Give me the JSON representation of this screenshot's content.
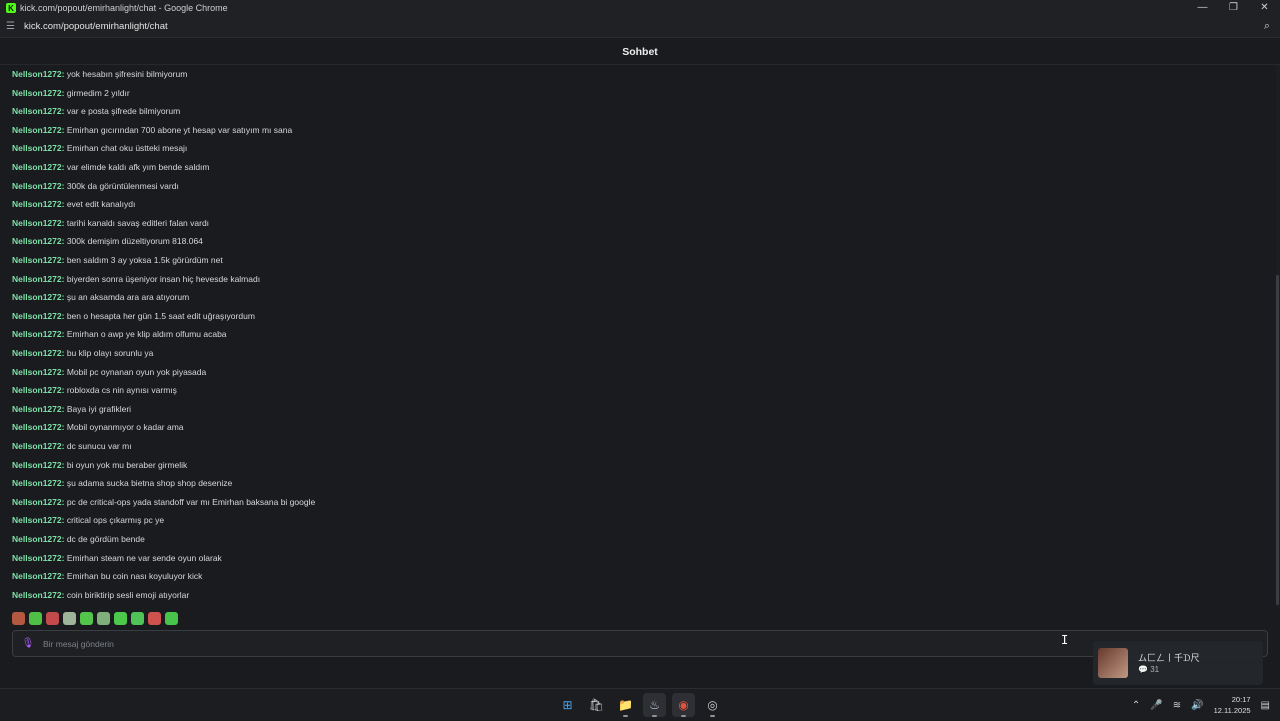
{
  "window": {
    "title": "kick.com/popout/emirhanlight/chat - Google Chrome",
    "app_icon": "K",
    "controls": [
      "—",
      "❐",
      "✕"
    ]
  },
  "browser": {
    "url": "kick.com/popout/emirhanlight/chat"
  },
  "chat": {
    "title": "Sohbet",
    "messages": [
      {
        "user": "Nellson1272:",
        "text": "yok hesabın şifresini bilmiyorum"
      },
      {
        "user": "Nellson1272:",
        "text": "girmedim 2 yıldır"
      },
      {
        "user": "Nellson1272:",
        "text": "var e posta şifrede bilmiyorum"
      },
      {
        "user": "Nellson1272:",
        "text": "Emirhan gıcırından 700 abone yt hesap var satıyım mı sana"
      },
      {
        "user": "Nellson1272:",
        "text": "Emirhan chat oku üstteki mesajı"
      },
      {
        "user": "Nellson1272:",
        "text": "var elimde kaldı afk yım bende saldım"
      },
      {
        "user": "Nellson1272:",
        "text": "300k da görüntülenmesi vardı"
      },
      {
        "user": "Nellson1272:",
        "text": "evet edit kanalıydı"
      },
      {
        "user": "Nellson1272:",
        "text": "tarihi kanaldı savaş editleri falan vardı"
      },
      {
        "user": "Nellson1272:",
        "text": "300k demişim düzeltiyorum 818.064"
      },
      {
        "user": "Nellson1272:",
        "text": "ben saldım 3 ay yoksa 1.5k görürdüm net"
      },
      {
        "user": "Nellson1272:",
        "text": "biyerden sonra üşeniyor insan hiç hevesde kalmadı"
      },
      {
        "user": "Nellson1272:",
        "text": "şu an aksamda ara ara atıyorum"
      },
      {
        "user": "Nellson1272:",
        "text": "ben o hesapta her gün 1.5 saat edit uğraşıyordum"
      },
      {
        "user": "Nellson1272:",
        "text": "Emirhan o awp ye klip aldım olfumu acaba"
      },
      {
        "user": "Nellson1272:",
        "text": "bu klip olayı sorunlu ya"
      },
      {
        "user": "Nellson1272:",
        "text": "Mobil pc oynanan oyun yok piyasada"
      },
      {
        "user": "Nellson1272:",
        "text": "robloxda cs nin aynısı varmış"
      },
      {
        "user": "Nellson1272:",
        "text": "Baya iyi grafikleri"
      },
      {
        "user": "Nellson1272:",
        "text": "Mobil oynanmıyor o kadar ama"
      },
      {
        "user": "Nellson1272:",
        "text": "dc sunucu var mı"
      },
      {
        "user": "Nellson1272:",
        "text": "bi oyun yok mu beraber girmelik"
      },
      {
        "user": "Nellson1272:",
        "text": "şu adama sucka bietna shop shop desenize"
      },
      {
        "user": "Nellson1272:",
        "text": "pc de critical-ops yada standoff var mı Emirhan baksana bi google"
      },
      {
        "user": "Nellson1272:",
        "text": "critical ops çıkarmış pc ye"
      },
      {
        "user": "Nellson1272:",
        "text": "dc de gördüm bende"
      },
      {
        "user": "Nellson1272:",
        "text": "Emirhan steam ne var sende oyun olarak"
      },
      {
        "user": "Nellson1272:",
        "text": "Emirhan bu coin nası koyuluyor kick"
      },
      {
        "user": "Nellson1272:",
        "text": "coin biriktirip sesli emoji atıyorlar"
      }
    ],
    "emotes": [
      {
        "name": "emote-1-icon",
        "color": "#b4583f"
      },
      {
        "name": "emote-2-icon",
        "color": "#4fbf45"
      },
      {
        "name": "emote-3-icon",
        "color": "#c34a4a"
      },
      {
        "name": "emote-4-icon",
        "color": "#9fb59a"
      },
      {
        "name": "emote-5-icon",
        "color": "#52c54a"
      },
      {
        "name": "emote-6-icon",
        "color": "#7fb07c"
      },
      {
        "name": "emote-7-icon",
        "color": "#4cc94a"
      },
      {
        "name": "emote-8-icon",
        "color": "#4fc258"
      },
      {
        "name": "emote-9-icon",
        "color": "#d0524e"
      },
      {
        "name": "emote-10-icon",
        "color": "#48c44a"
      }
    ],
    "input": {
      "placeholder": "Bir mesaj gönderin",
      "value": ""
    }
  },
  "notification": {
    "title": "ム匚ㄥ丨千ᗪ尺",
    "count": "31"
  },
  "taskbar": {
    "apps": [
      {
        "name": "start-icon",
        "glyph": "⊞",
        "color": "#4aa3e8"
      },
      {
        "name": "store-icon",
        "glyph": "🛍",
        "color": "#c9c9c9"
      },
      {
        "name": "file-explorer-icon",
        "glyph": "📁",
        "color": "#e8b84a"
      },
      {
        "name": "steam-icon",
        "glyph": "♨",
        "color": "#c7d5e0"
      },
      {
        "name": "chrome-icon",
        "glyph": "◉",
        "color": "#e0533f"
      },
      {
        "name": "discord-icon",
        "glyph": "◎",
        "color": "#cfcfcf"
      }
    ],
    "time": "20:17",
    "date": "12.11.2025"
  },
  "colors": {
    "background": "#191b1f",
    "username": "#7fe0a8",
    "mic_accent": "#b05cff"
  }
}
